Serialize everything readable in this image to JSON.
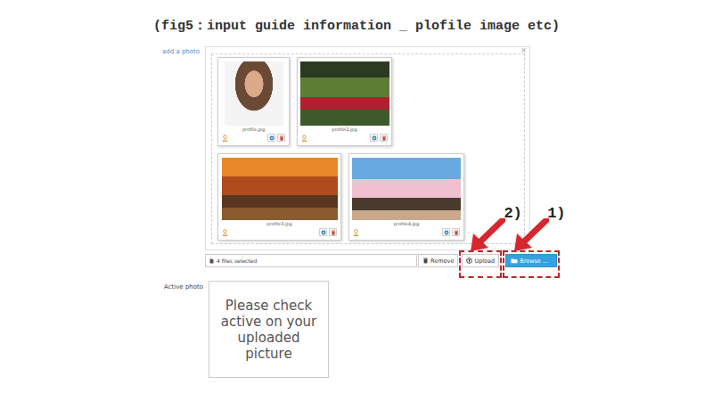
{
  "title": "(fig5：input guide information _ plofile image etc)",
  "add_photo_label": "add a photo",
  "close": "×",
  "thumbnails": [
    {
      "filename": "profile.jpg"
    },
    {
      "filename": "profile2.jpg"
    },
    {
      "filename": "profile3.jpg"
    },
    {
      "filename": "profile4.jpg"
    }
  ],
  "file_field": {
    "text": "4 files selected"
  },
  "buttons": [
    {
      "label": "Remove",
      "kind": "remove"
    },
    {
      "label": "Upload",
      "kind": "upload",
      "annotation": "2)"
    },
    {
      "label": "Browse ...",
      "kind": "browse",
      "annotation": "1)"
    }
  ],
  "active_photo": {
    "label": "Active photo",
    "placeholder_text": "Please check active on your uploaded picture"
  }
}
